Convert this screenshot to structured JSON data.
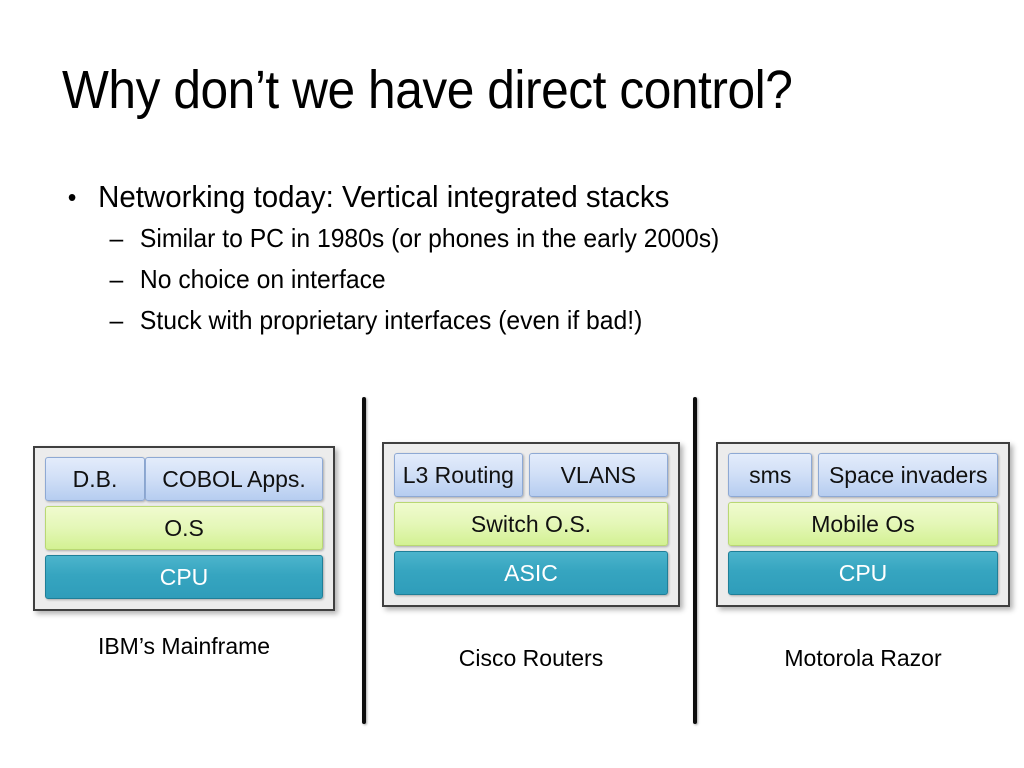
{
  "slide": {
    "title": "Why don’t we have direct control?",
    "bullets": [
      {
        "level": 1,
        "marker": "•",
        "text": "Networking today: Vertical integrated stacks"
      },
      {
        "level": 2,
        "marker": "–",
        "text": "Similar to PC in 1980s (or phones in the early 2000s)"
      },
      {
        "level": 2,
        "marker": "–",
        "text": "No choice on interface"
      },
      {
        "level": 2,
        "marker": "–",
        "text": "Stuck with proprietary interfaces (even if bad!)"
      }
    ],
    "colors": {
      "app_layer": "#c6d9f0",
      "os_layer": "#dff3a6",
      "hardware_layer": "#36a5c0",
      "frame_border": "#3f3f3f",
      "frame_fill": "#ececec",
      "divider": "#0d0d0d",
      "text": "#000000"
    },
    "stacks": [
      {
        "caption": "IBM’s Mainframe",
        "app_row": [
          {
            "label": "D.B.",
            "width_pct": 36
          },
          {
            "label": "COBOL Apps.",
            "width_pct": 64
          }
        ],
        "os_layer": "O.S",
        "hardware_layer": "CPU"
      },
      {
        "caption": "Cisco Routers",
        "app_row": [
          {
            "label": "L3 Routing",
            "width_pct": 48
          },
          {
            "label": "VLANS",
            "width_pct": 52
          }
        ],
        "os_layer": "Switch O.S.",
        "hardware_layer": "ASIC"
      },
      {
        "caption": "Motorola Razor",
        "app_row": [
          {
            "label": "sms",
            "width_pct": 32
          },
          {
            "label": "Space invaders",
            "width_pct": 68
          }
        ],
        "os_layer": "Mobile Os",
        "hardware_layer": "CPU"
      }
    ]
  }
}
